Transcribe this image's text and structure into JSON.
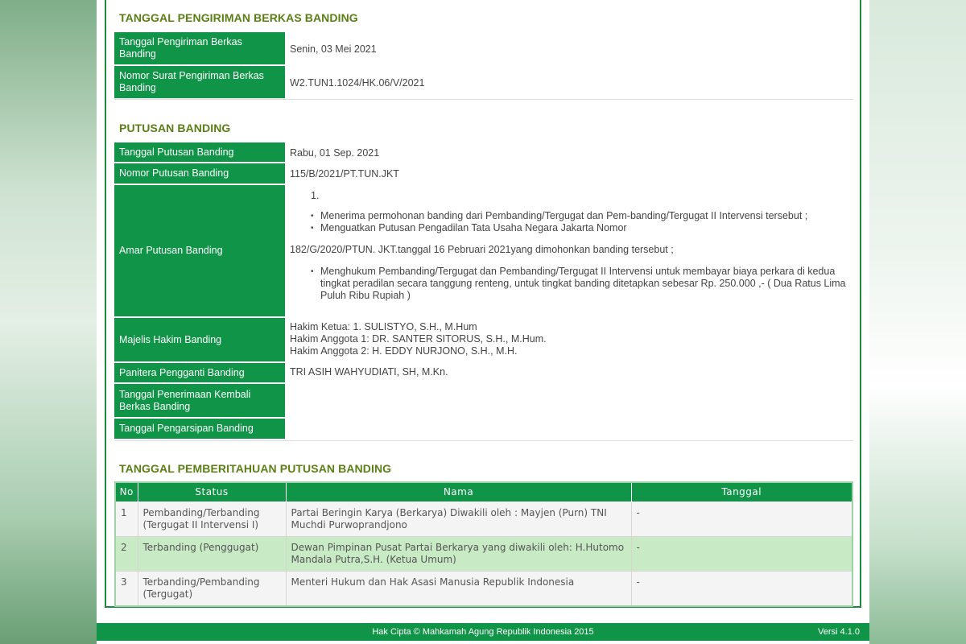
{
  "section1": {
    "title": "TANGGAL PENGIRIMAN BERKAS BANDING",
    "rows": [
      {
        "label": "Tanggal Pengiriman Berkas Banding",
        "value": "Senin, 03 Mei 2021"
      },
      {
        "label": "Nomor Surat Pengiriman Berkas Banding",
        "value": "W2.TUN1.1024/HK.06/V/2021"
      }
    ]
  },
  "section2": {
    "title": "PUTUSAN BANDING",
    "tanggal_label": "Tanggal Putusan Banding",
    "tanggal_value": "Rabu, 01 Sep. 2021",
    "nomor_label": "Nomor Putusan Banding",
    "nomor_value": "115/B/2021/PT.TUN.JKT",
    "amar_label": "Amar Putusan Banding",
    "amar_num": "1.",
    "amar_items_a": [
      "Menerima   permohonan banding dari Pembanding/Tergugat dan Pem-banding/Tergugat II Intervensi tersebut ;",
      "Menguatkan  Putusan  Pengadilan  Tata Usaha Negara  Jakarta  Nomor"
    ],
    "amar_mid": "182/G/2020/PTUN. JKT.tanggal 16 Pebruari 2021yang dimohonkan banding tersebut ;",
    "amar_items_b": [
      "Menghukum Pembanding/Tergugat dan Pembanding/Tergugat II Intervensi  untuk membayar biaya perkara di kedua tingkat peradilan secara tanggung renteng, untuk tingkat  banding ditetapkan sebesar Rp. 250.000 ,- ( Dua Ratus Lima Puluh Ribu Rupiah )"
    ],
    "majelis_label": "Majelis Hakim Banding",
    "majelis_lines": [
      "Hakim Ketua: 1. SULISTYO, S.H., M.Hum",
      "Hakim Anggota 1: DR. SANTER SITORUS, S.H., M.Hum.",
      "Hakim Anggota 2: H. EDDY NURJONO, S.H., M.H."
    ],
    "panitera_label": "Panitera Pengganti Banding",
    "panitera_value": "TRI ASIH WAHYUDIATI, SH, M.Kn.",
    "penerimaan_label": "Tanggal Penerimaan Kembali Berkas Banding",
    "penerimaan_value": "",
    "pengarsipan_label": "Tanggal Pengarsipan Banding",
    "pengarsipan_value": ""
  },
  "section3": {
    "title": "TANGGAL PEMBERITAHUAN PUTUSAN BANDING",
    "headers": [
      "No",
      "Status",
      "Nama",
      "Tanggal"
    ],
    "rows": [
      {
        "no": "1",
        "status": "Pembanding/Terbanding (Tergugat II Intervensi I)",
        "nama": "Partai Beringin Karya (Berkarya) Diwakili oleh : Mayjen (Purn) TNI Muchdi Purwoprandjono",
        "tanggal": "-"
      },
      {
        "no": "2",
        "status": "Terbanding (Penggugat)",
        "nama": "Dewan Pimpinan Pusat Partai Berkarya yang diwakili oleh: H.Hutomo Mandala Putra,S.H. (Ketua Umum)",
        "tanggal": "-"
      },
      {
        "no": "3",
        "status": "Terbanding/Pembanding (Tergugat)",
        "nama": "Menteri Hukum dan Hak Asasi Manusia Republik Indonesia",
        "tanggal": "-"
      }
    ]
  },
  "footer": {
    "copyright": "Hak Cipta © Mahkamah Agung Republik Indonesia 2015",
    "version": "Versi 4.1.0"
  },
  "colors": {
    "header_green": "#109447",
    "title_olive": "#5a7f14",
    "alt_row": "#c8ebc6"
  }
}
